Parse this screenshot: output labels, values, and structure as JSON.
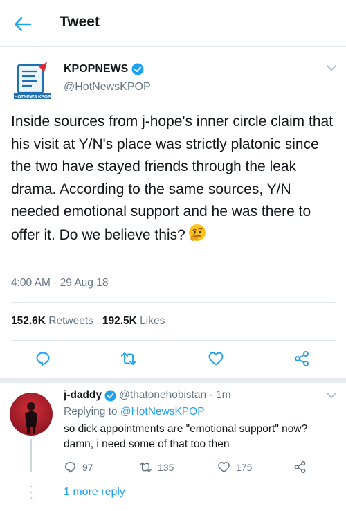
{
  "header": {
    "title": "Tweet",
    "back_icon": "arrow-left-icon"
  },
  "tweet": {
    "author_name": "KPOPNEWS",
    "author_handle": "@HotNewsKPOP",
    "logo_text": "HOTNEWS KPOP",
    "text": "Inside sources from j-hope's inner circle claim that his visit at Y/N's place was strictly platonic since the two have stayed friends through the leak drama. According to the same sources, Y/N needed emotional support and he was there to offer it. Do we believe this?",
    "emoji": "thinking-face-icon",
    "timestamp": "4:00 AM · 29 Aug 18",
    "retweets_count": "152.6K",
    "retweets_label": "Retweets",
    "likes_count": "192.5K",
    "likes_label": "Likes"
  },
  "reply": {
    "author_name": "j-daddy",
    "handle_time": "@thatonehobistan · 1m",
    "replying_prefix": "Replying to",
    "replying_handle": "@HotNewsKPOP",
    "text": "so dick appointments are \"emotional support\" now? damn, i need some of that too then",
    "reply_count": "97",
    "retweet_count": "135",
    "like_count": "175",
    "more_replies": "1 more reply"
  },
  "colors": {
    "accent": "#1da1f2",
    "secondary_text": "#657786",
    "divider": "#e1e8ed"
  }
}
